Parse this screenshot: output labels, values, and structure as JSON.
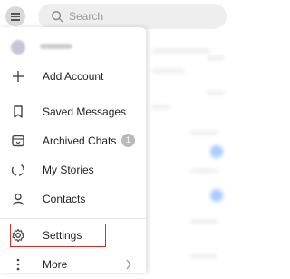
{
  "search": {
    "placeholder": "Search"
  },
  "drawer": {
    "account": {
      "name_hidden": true
    },
    "add_account": "Add Account",
    "menu": [
      {
        "label": "Saved Messages",
        "icon": "bookmark-icon"
      },
      {
        "label": "Archived Chats",
        "icon": "archive-icon",
        "badge": "1"
      },
      {
        "label": "My Stories",
        "icon": "stories-icon"
      },
      {
        "label": "Contacts",
        "icon": "contacts-icon"
      }
    ],
    "settings": "Settings",
    "more": "More"
  },
  "colors": {
    "highlight": "#d32f2f",
    "badge": "#b9b9b9",
    "unread_dot": "#6fa8ff"
  }
}
